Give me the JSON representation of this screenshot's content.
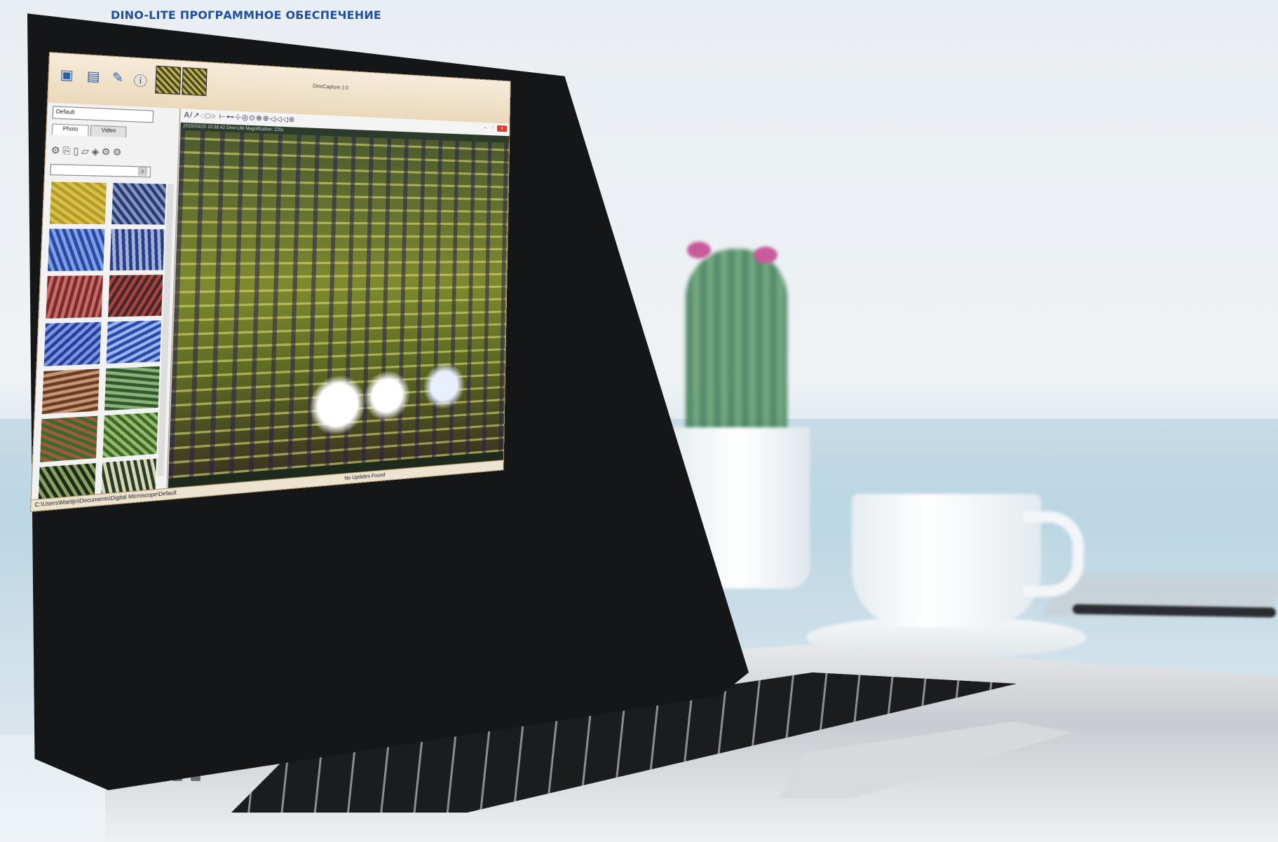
{
  "page": {
    "heading": "DINO-LITE ПРОГРАММНОЕ ОБЕСПЕЧЕНИЕ"
  },
  "app": {
    "title": "DinoCapture 2.0",
    "profile_value": "Default",
    "tabs": [
      {
        "label": "Photo",
        "active": true
      },
      {
        "label": "Video",
        "active": false
      }
    ],
    "toolbar_icons": [
      "preview-icon",
      "display-icon",
      "pen-icon",
      "info-icon"
    ],
    "tools_glyphs": "⚙⎘▯▱◈⚙⚙",
    "drawing_tools": "A/↗◌□○ ⊢⊷⊹◎⊙⊗⊕◁◁◁⊛",
    "info_text": "2015/03/20 10:38:42   Dino-Lite Magnification: 220x",
    "status_path": "C:\\Users\\Martijn\\Documents\\Digital Microscope\\Default",
    "status_updates": "No Updates Found",
    "window_close": "x",
    "thumbnails": [
      {
        "colors": [
          "#b59a2a",
          "#d6c24a"
        ]
      },
      {
        "colors": [
          "#2c3a6c",
          "#7f96c8"
        ]
      },
      {
        "colors": [
          "#2a48a8",
          "#7da0e0"
        ]
      },
      {
        "colors": [
          "#2a3c8a",
          "#9fb2d8"
        ]
      },
      {
        "colors": [
          "#7a2c2c",
          "#c86a6a"
        ]
      },
      {
        "colors": [
          "#3e2a2a",
          "#b04040"
        ]
      },
      {
        "colors": [
          "#2a3ca0",
          "#7b97dc"
        ]
      },
      {
        "colors": [
          "#2a48a8",
          "#98b4ec"
        ]
      },
      {
        "colors": [
          "#6a3a22",
          "#c79674"
        ]
      },
      {
        "colors": [
          "#2e5a2e",
          "#8db07a"
        ]
      },
      {
        "colors": [
          "#3c6a2c",
          "#a05a3c"
        ]
      },
      {
        "colors": [
          "#3a6a2a",
          "#9ab86a"
        ]
      },
      {
        "colors": [
          "#1c2a1c",
          "#8aa05c"
        ]
      },
      {
        "colors": [
          "#2a3a2a",
          "#d8d8b0"
        ]
      },
      {
        "colors": [
          "#2a3a1a",
          "#a0b860"
        ]
      },
      {
        "colors": [
          "#4a4a4a",
          "#b4b4b4"
        ]
      }
    ]
  }
}
